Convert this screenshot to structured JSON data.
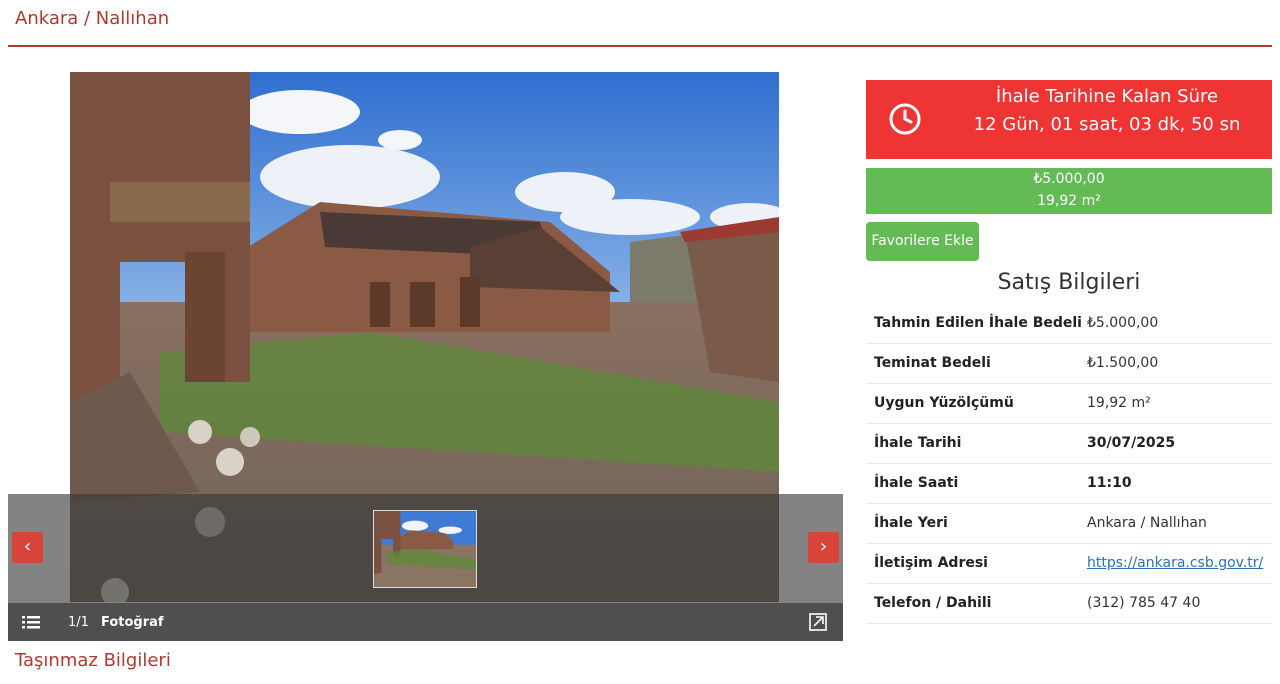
{
  "header": {
    "title": "Ankara / Nallıhan"
  },
  "gallery": {
    "count": "1/1",
    "label": "Fotoğraf",
    "prev_arrow": "‹",
    "next_arrow": "›"
  },
  "countdown": {
    "title": "İhale Tarihine Kalan Süre",
    "time": "12 Gün, 01 saat, 03 dk, 50 sn",
    "color": "#ef3434"
  },
  "price": {
    "amount": "₺5.000,00",
    "area": "19,92 m²",
    "color": "#64bb56"
  },
  "favorite_button": {
    "label": "Favorilere Ekle"
  },
  "sales": {
    "title": "Satış Bilgileri",
    "rows": [
      {
        "label": "Tahmin Edilen İhale Bedeli",
        "value": "₺5.000,00"
      },
      {
        "label": "Teminat Bedeli",
        "value": "₺1.500,00"
      },
      {
        "label": "Uygun Yüzölçümü",
        "value": "19,92 m²"
      },
      {
        "label": "İhale Tarihi",
        "value": "30/07/2025"
      },
      {
        "label": "İhale Saati",
        "value": "11:10"
      },
      {
        "label": "İhale Yeri",
        "value": "Ankara / Nallıhan"
      },
      {
        "label": "İletişim Adresi",
        "value": "https://ankara.csb.gov.tr/"
      },
      {
        "label": "Telefon / Dahili",
        "value": "(312) 785 47 40"
      }
    ]
  },
  "section": {
    "title": "Taşınmaz Bilgileri"
  },
  "brand_color": "#b03a30"
}
